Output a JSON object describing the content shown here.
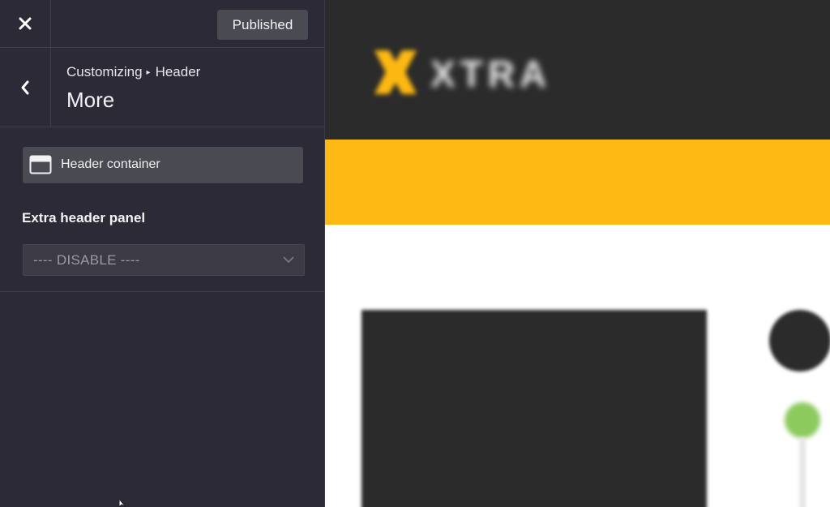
{
  "topbar": {
    "close_icon": "close-icon",
    "publish_label": "Published"
  },
  "section": {
    "back_icon": "chevron-left-icon",
    "breadcrumb": {
      "root": "Customizing",
      "separator": "▸",
      "parent": "Header"
    },
    "title": "More"
  },
  "controls": {
    "header_container": {
      "icon": "layout-header-icon",
      "label": "Header container"
    },
    "extra_header_panel": {
      "label": "Extra header panel",
      "selected": "---- DISABLE ----"
    }
  },
  "colors": {
    "sidebar_bg": "#2b2a36",
    "button_bg": "#4a4a52",
    "preview_band": "#fdb913",
    "preview_dark": "#2b2b2b",
    "preview_green": "#8cca5e"
  }
}
